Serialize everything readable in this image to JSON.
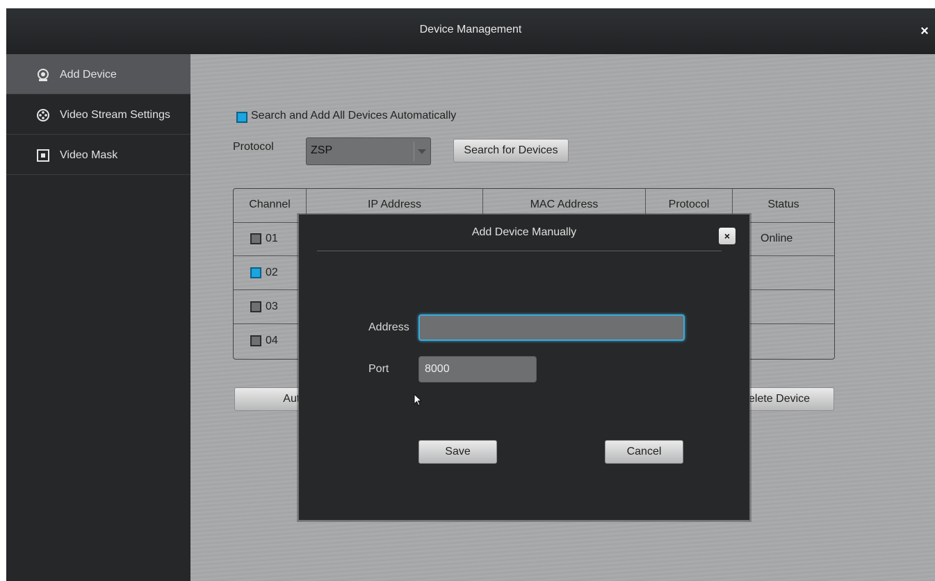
{
  "window": {
    "title": "Device Management",
    "close_label": "×"
  },
  "sidebar": {
    "items": [
      {
        "label": "Add Device",
        "icon": "webcam-icon",
        "active": true
      },
      {
        "label": "Video Stream Settings",
        "icon": "film-reel-icon",
        "active": false
      },
      {
        "label": "Video Mask",
        "icon": "square-mask-icon",
        "active": false
      }
    ]
  },
  "main": {
    "auto_search_label": "Search and Add All Devices Automatically",
    "auto_search_checked": true,
    "protocol_label": "Protocol",
    "protocol_value": "ZSP",
    "search_button": "Search for Devices",
    "table": {
      "headers": [
        "Channel",
        "IP Address",
        "MAC Address",
        "Protocol",
        "Status"
      ],
      "rows": [
        {
          "channel": "01",
          "checked": false,
          "status": "Online"
        },
        {
          "channel": "02",
          "checked": true,
          "status": ""
        },
        {
          "channel": "03",
          "checked": false,
          "status": ""
        },
        {
          "channel": "04",
          "checked": false,
          "status": ""
        }
      ]
    },
    "auto_button": "Auto ...",
    "delete_button": "elete Device"
  },
  "dialog": {
    "title": "Add Device Manually",
    "close_label": "×",
    "address_label": "Address",
    "address_value": "",
    "port_label": "Port",
    "port_value": "8000",
    "save_button": "Save",
    "cancel_button": "Cancel"
  },
  "colors": {
    "accent": "#1aa6e0",
    "titlebar": "#2a2c2e",
    "panel": "#a7a8a9",
    "dialog": "#272829"
  }
}
